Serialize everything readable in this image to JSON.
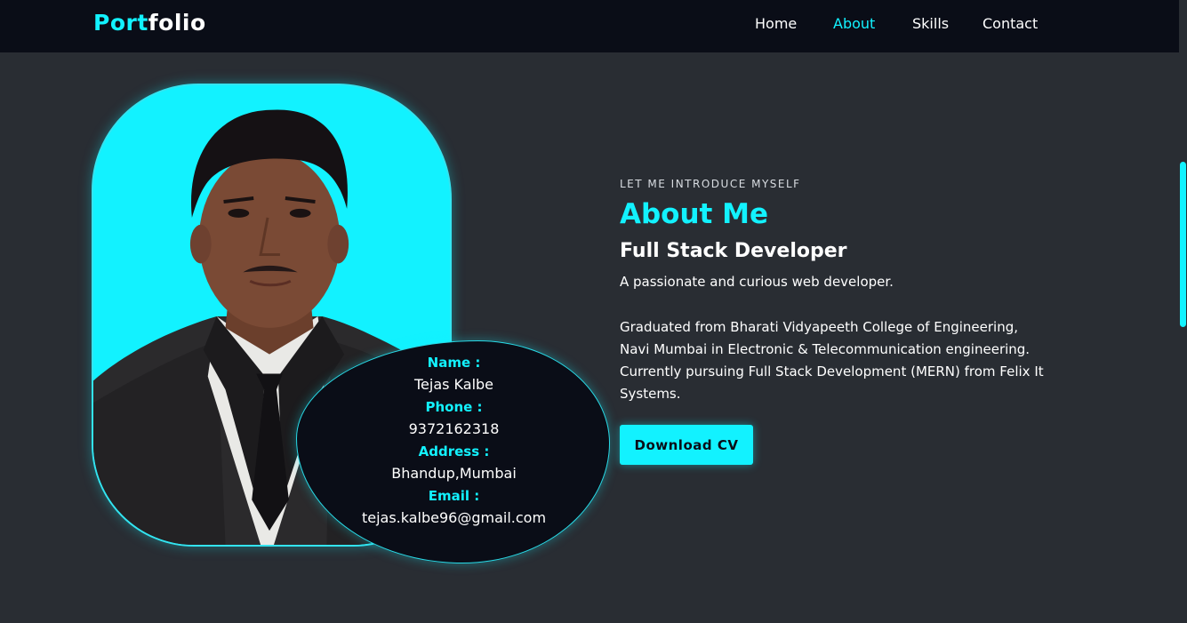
{
  "navbar": {
    "logo_part1": "Port",
    "logo_part2": "folio",
    "links": [
      {
        "label": "Home",
        "active": false
      },
      {
        "label": "About",
        "active": true
      },
      {
        "label": "Skills",
        "active": false
      },
      {
        "label": "Contact",
        "active": false
      }
    ]
  },
  "profile_card": {
    "name_label": "Name :",
    "name": "Tejas Kalbe",
    "phone_label": "Phone :",
    "phone": "9372162318",
    "address_label": "Address :",
    "address": "Bhandup,Mumbai",
    "email_label": "Email :",
    "email": "tejas.kalbe96@gmail.com"
  },
  "about": {
    "kicker": "LET ME INTRODUCE MYSELF",
    "title": "About Me",
    "role": "Full Stack Developer",
    "tagline": "A passionate and curious web developer.",
    "bio_lines": [
      "Graduated from Bharati Vidyapeeth College of Engineering,",
      "Navi Mumbai in Electronic & Telecommunication engineering.",
      "Currently pursuing Full Stack Development (MERN) from Felix It",
      "Systems."
    ],
    "cv_button": "Download CV"
  },
  "colors": {
    "accent": "#12f2ff",
    "navbar_bg": "#0a0d17",
    "page_bg": "#292d33"
  }
}
